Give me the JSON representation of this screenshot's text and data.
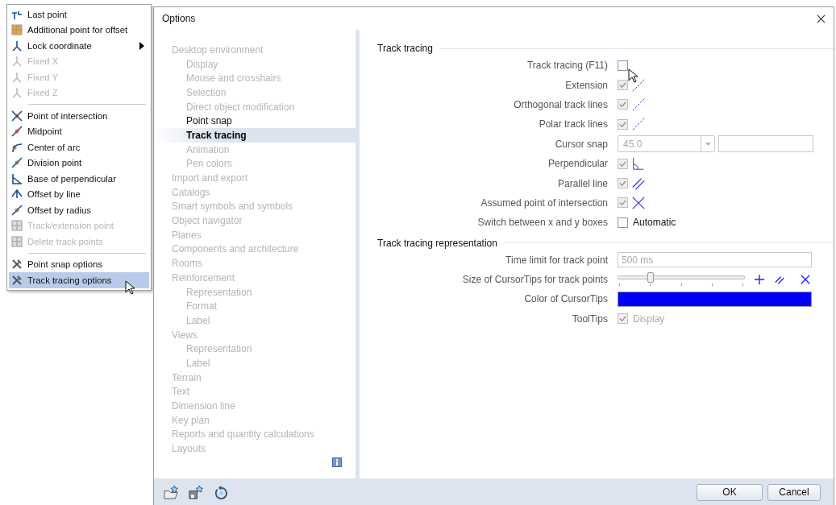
{
  "menu": {
    "groups": [
      [
        {
          "label": "Last point",
          "disabled": false,
          "selected": false,
          "submenu": false
        },
        {
          "label": "Additional point for offset",
          "disabled": false,
          "selected": false,
          "submenu": false
        },
        {
          "label": "Lock coordinate",
          "disabled": false,
          "selected": false,
          "submenu": true
        },
        {
          "label": "Fixed X",
          "disabled": true,
          "selected": false,
          "submenu": false
        },
        {
          "label": "Fixed Y",
          "disabled": true,
          "selected": false,
          "submenu": false
        },
        {
          "label": "Fixed Z",
          "disabled": true,
          "selected": false,
          "submenu": false
        }
      ],
      [
        {
          "label": "Point of intersection",
          "disabled": false,
          "selected": false,
          "submenu": false
        },
        {
          "label": "Midpoint",
          "disabled": false,
          "selected": false,
          "submenu": false
        },
        {
          "label": "Center of arc",
          "disabled": false,
          "selected": false,
          "submenu": false
        },
        {
          "label": "Division point",
          "disabled": false,
          "selected": false,
          "submenu": false
        },
        {
          "label": "Base of perpendicular",
          "disabled": false,
          "selected": false,
          "submenu": false
        },
        {
          "label": "Offset by line",
          "disabled": false,
          "selected": false,
          "submenu": false
        },
        {
          "label": "Offset by radius",
          "disabled": false,
          "selected": false,
          "submenu": false
        },
        {
          "label": "Track/extension point",
          "disabled": true,
          "selected": false,
          "submenu": false
        },
        {
          "label": "Delete track points",
          "disabled": true,
          "selected": false,
          "submenu": false
        }
      ],
      [
        {
          "label": "Point snap options",
          "disabled": false,
          "selected": false,
          "submenu": false
        },
        {
          "label": "Track tracing options",
          "disabled": false,
          "selected": true,
          "submenu": false
        }
      ]
    ]
  },
  "dialog": {
    "title": "Options",
    "nav": [
      {
        "label": "Desktop environment",
        "disabled": true,
        "selected": false,
        "children": [
          {
            "label": "Display",
            "disabled": true,
            "selected": false
          },
          {
            "label": "Mouse and crosshairs",
            "disabled": true,
            "selected": false
          },
          {
            "label": "Selection",
            "disabled": true,
            "selected": false
          },
          {
            "label": "Direct object modification",
            "disabled": true,
            "selected": false
          },
          {
            "label": "Point snap",
            "disabled": false,
            "selected": false
          },
          {
            "label": "Track tracing",
            "disabled": false,
            "selected": true
          },
          {
            "label": "Animation",
            "disabled": true,
            "selected": false
          },
          {
            "label": "Pen colors",
            "disabled": true,
            "selected": false
          }
        ]
      },
      {
        "label": "Import and export",
        "disabled": true,
        "selected": false
      },
      {
        "label": "Catalogs",
        "disabled": true,
        "selected": false
      },
      {
        "label": "Smart symbols and symbols",
        "disabled": true,
        "selected": false
      },
      {
        "label": "Object navigator",
        "disabled": true,
        "selected": false
      },
      {
        "label": "Planes",
        "disabled": true,
        "selected": false
      },
      {
        "label": "Components and architecture",
        "disabled": true,
        "selected": false
      },
      {
        "label": "Rooms",
        "disabled": true,
        "selected": false
      },
      {
        "label": "Reinforcement",
        "disabled": true,
        "selected": false,
        "children": [
          {
            "label": "Representation",
            "disabled": true,
            "selected": false
          },
          {
            "label": "Format",
            "disabled": true,
            "selected": false
          },
          {
            "label": "Label",
            "disabled": true,
            "selected": false
          }
        ]
      },
      {
        "label": "Views",
        "disabled": true,
        "selected": false,
        "children": [
          {
            "label": "Representation",
            "disabled": true,
            "selected": false
          },
          {
            "label": "Label",
            "disabled": true,
            "selected": false
          }
        ]
      },
      {
        "label": "Terrain",
        "disabled": true,
        "selected": false
      },
      {
        "label": "Text",
        "disabled": true,
        "selected": false
      },
      {
        "label": "Dimension line",
        "disabled": true,
        "selected": false
      },
      {
        "label": "Key plan",
        "disabled": true,
        "selected": false
      },
      {
        "label": "Reports and quantity calculations",
        "disabled": true,
        "selected": false
      },
      {
        "label": "Layouts",
        "disabled": true,
        "selected": false
      }
    ],
    "sections": [
      {
        "title": "Track tracing",
        "rows": [
          {
            "kind": "check",
            "label": "Track tracing (F11)",
            "checked": false,
            "disabled": false
          },
          {
            "kind": "check",
            "label": "Extension",
            "checked": true,
            "disabled": true
          },
          {
            "kind": "check",
            "label": "Orthogonal track lines",
            "checked": true,
            "disabled": true
          },
          {
            "kind": "check",
            "label": "Polar track lines",
            "checked": true,
            "disabled": true
          },
          {
            "kind": "combo",
            "label": "Cursor snap",
            "value": "45.0",
            "disabled": true
          },
          {
            "kind": "check",
            "label": "Perpendicular",
            "checked": true,
            "disabled": true
          },
          {
            "kind": "check",
            "label": "Parallel line",
            "checked": true,
            "disabled": true
          },
          {
            "kind": "check",
            "label": "Assumed point of intersection",
            "checked": true,
            "disabled": true
          },
          {
            "kind": "check",
            "label": "Switch between x and y boxes",
            "checked": false,
            "disabled": false,
            "caption": "Automatic"
          }
        ]
      },
      {
        "title": "Track tracing representation",
        "rows": [
          {
            "kind": "input",
            "label": "Time limit for track point",
            "value": "500 ms",
            "disabled": true
          },
          {
            "kind": "slider",
            "label": "Size of CursorTips for track points",
            "level": 0.25
          },
          {
            "kind": "color",
            "label": "Color of CursorTips",
            "color": "#0000ff"
          },
          {
            "kind": "check",
            "label": "ToolTips",
            "checked": true,
            "disabled": true,
            "caption": "Display"
          }
        ]
      }
    ],
    "buttons": [
      "OK",
      "Cancel"
    ]
  }
}
